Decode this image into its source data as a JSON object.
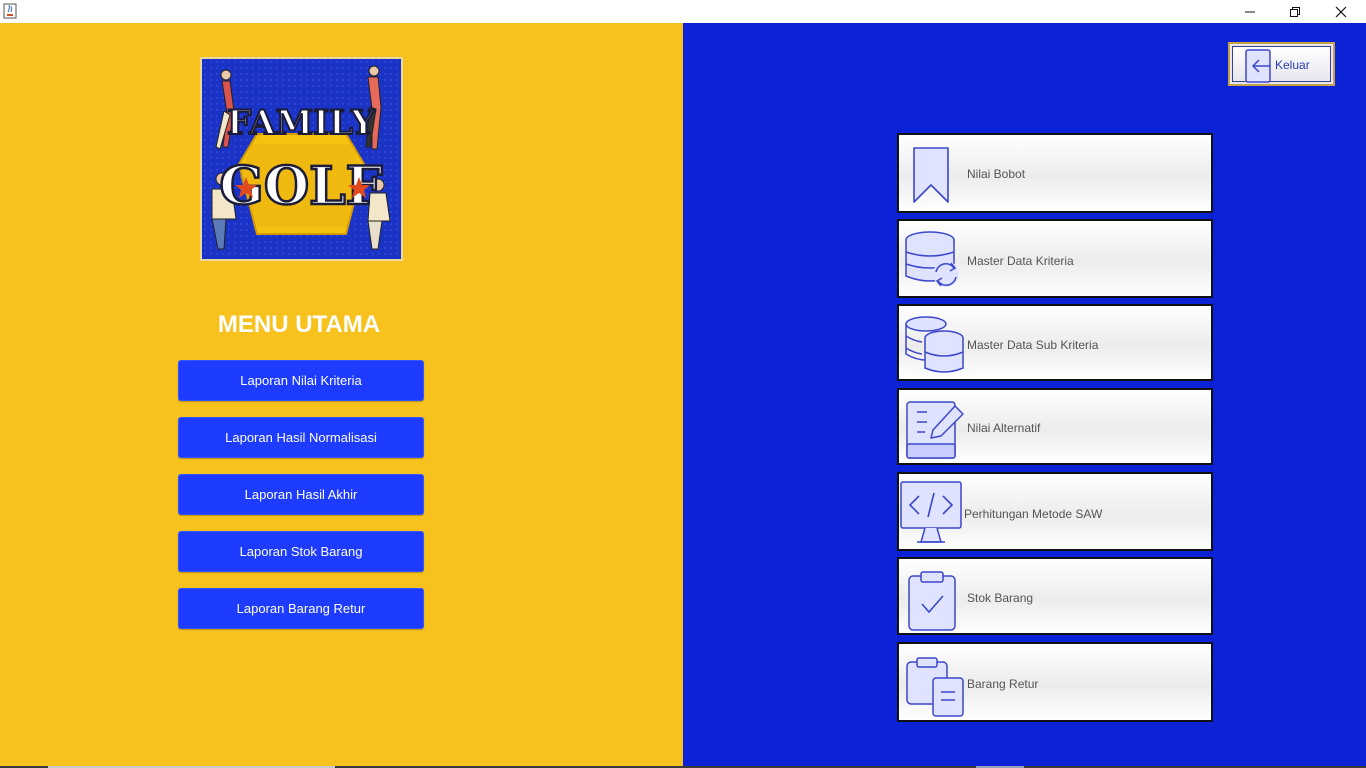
{
  "window": {
    "app_icon": "java-cup-icon",
    "controls": [
      "minimize-icon",
      "restore-icon",
      "close-icon"
    ]
  },
  "logo": {
    "text_line1": "FAMILY",
    "text_line2": "GOLF"
  },
  "left": {
    "title": "MENU UTAMA",
    "reports": [
      "Laporan Nilai Kriteria",
      "Laporan Hasil Normalisasi",
      "Laporan Hasil Akhir",
      "Laporan Stok Barang",
      "Laporan Barang Retur"
    ]
  },
  "right": {
    "exit_label": "Keluar",
    "menu": [
      {
        "label": "Nilai Bobot",
        "icon": "bookmark-icon"
      },
      {
        "label": "Master Data Kriteria",
        "icon": "database-sync-icon"
      },
      {
        "label": "Master Data Sub Kriteria",
        "icon": "database-stack-icon"
      },
      {
        "label": "Nilai Alternatif",
        "icon": "edit-document-icon"
      },
      {
        "label": "Perhitungan Metode SAW",
        "icon": "code-monitor-icon"
      },
      {
        "label": "Stok Barang",
        "icon": "clipboard-check-icon"
      },
      {
        "label": "Barang Retur",
        "icon": "clipboard-copy-icon"
      }
    ]
  },
  "colors": {
    "left_bg": "#f7c11e",
    "right_bg": "#0b22d6",
    "report_button": "#1e3cff",
    "icon_stroke": "#3b47c9"
  }
}
